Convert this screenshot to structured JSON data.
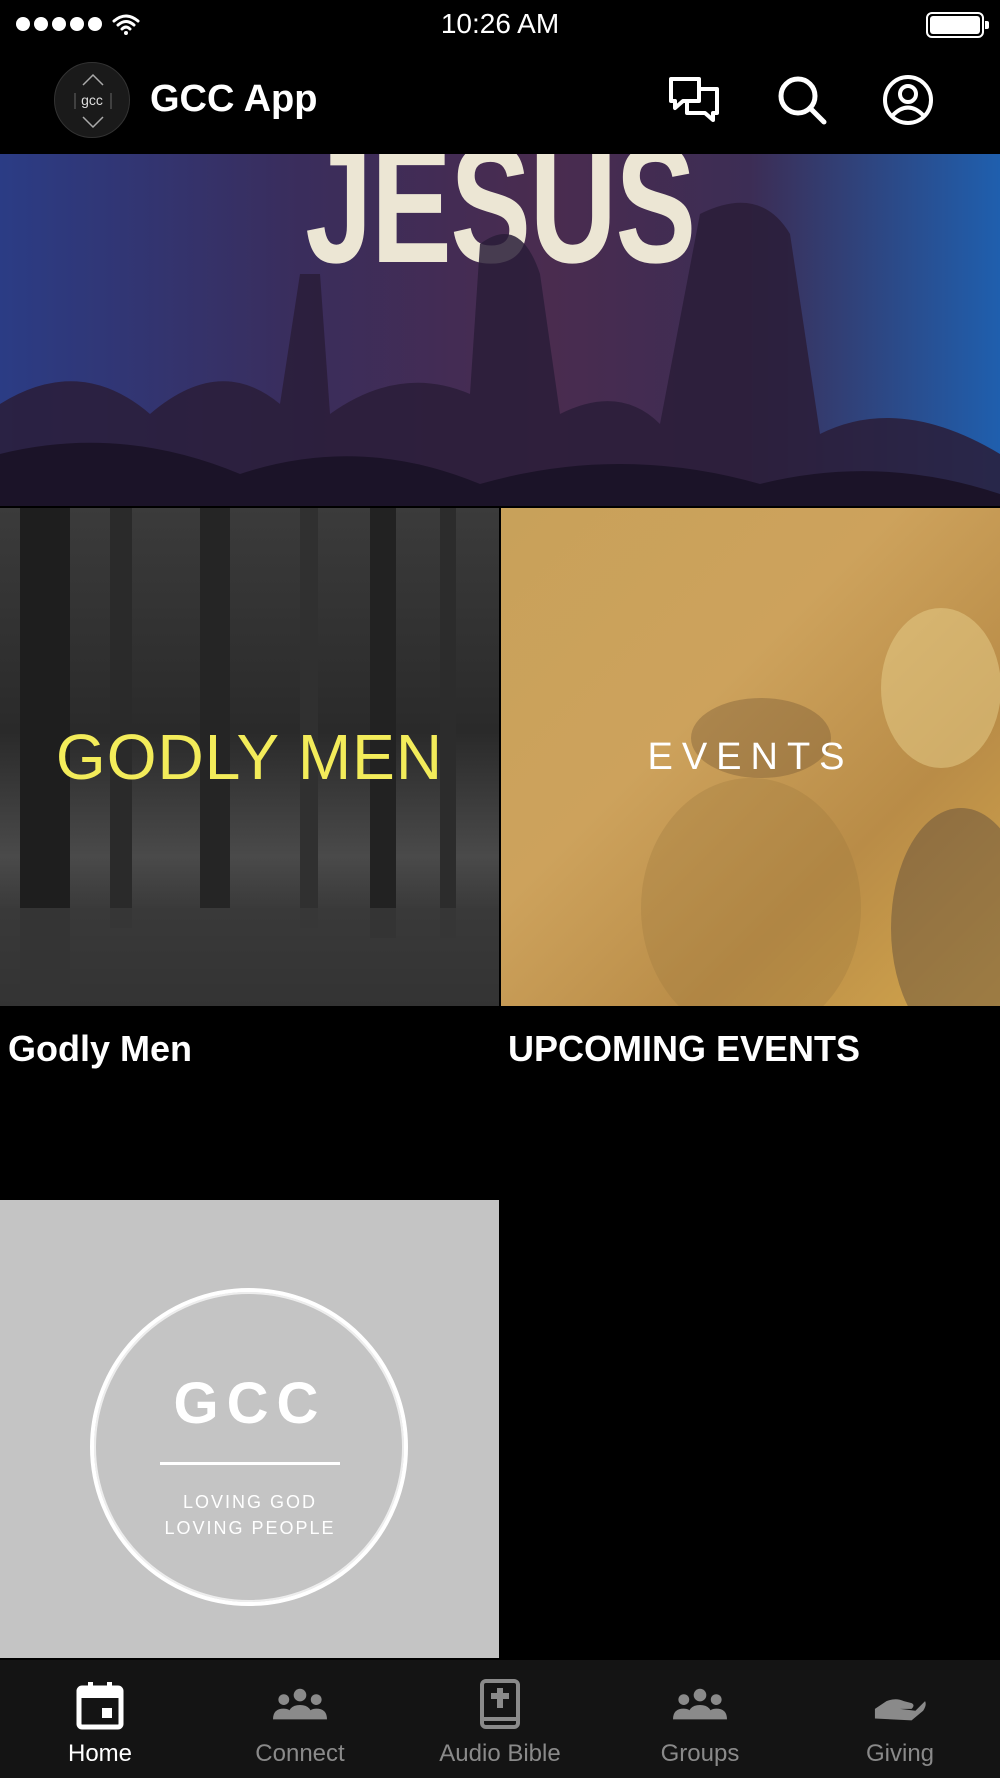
{
  "status_bar": {
    "time": "10:26 AM"
  },
  "header": {
    "logo_text": "gcc",
    "title": "GCC App",
    "icons": [
      "chat-icon",
      "search-icon",
      "account-icon"
    ]
  },
  "hero": {
    "text": "JESUS"
  },
  "tiles": [
    {
      "image_text": "GODLY MEN",
      "title": "Godly Men"
    },
    {
      "image_text": "EVENTS",
      "title": "UPCOMING EVENTS"
    },
    {
      "image_text": "GCC",
      "sub1": "LOVING GOD",
      "sub2": "LOVING PEOPLE",
      "title": ""
    }
  ],
  "tabs": [
    {
      "label": "Home",
      "icon": "calendar-icon",
      "active": true
    },
    {
      "label": "Connect",
      "icon": "people-icon",
      "active": false
    },
    {
      "label": "Audio Bible",
      "icon": "bible-icon",
      "active": false
    },
    {
      "label": "Groups",
      "icon": "people-icon",
      "active": false
    },
    {
      "label": "Giving",
      "icon": "giving-hand-icon",
      "active": false
    }
  ]
}
